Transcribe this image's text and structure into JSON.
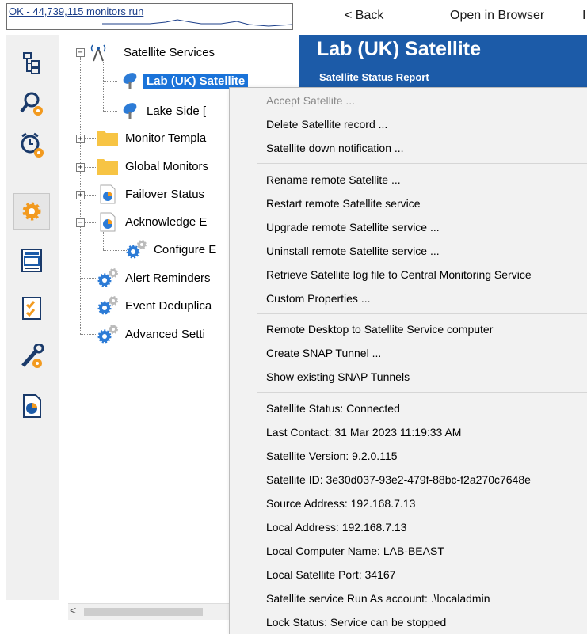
{
  "status_strip": {
    "text": "OK - 44,739,115 monitors run"
  },
  "browser_nav": {
    "back_label": "< Back",
    "open_label": "Open in Browser",
    "extra_label": "I"
  },
  "banner": {
    "title": "Lab (UK) Satellite",
    "subtitle": "Satellite Status Report"
  },
  "sidebar_icons": [
    "tree-view-icon",
    "search-gear-icon",
    "alarm-clock-icon",
    "settings-gear-icon",
    "news-report-icon",
    "checklist-icon",
    "tools-wrench-icon",
    "pie-report-icon"
  ],
  "tree": {
    "satellite_services": "Satellite Services",
    "lab_uk": "Lab (UK) Satellite",
    "lake_side": "Lake Side [",
    "monitor_templates": "Monitor Templa",
    "global_monitors": "Global Monitors",
    "failover_status": "Failover Status",
    "acknowledge": "Acknowledge E",
    "configure": "Configure E",
    "alert_reminders": "Alert Reminders",
    "event_dedup": "Event Deduplica",
    "advanced": "Advanced Setti"
  },
  "menu": {
    "items": [
      {
        "label": "Accept Satellite ...",
        "enabled": false
      },
      {
        "label": "Delete Satellite record ...",
        "enabled": true
      },
      {
        "label": "Satellite down notification ...",
        "enabled": true
      },
      {
        "label": "Rename remote Satellite ...",
        "enabled": true
      },
      {
        "label": "Restart remote Satellite service",
        "enabled": true
      },
      {
        "label": "Upgrade remote Satellite service ...",
        "enabled": true
      },
      {
        "label": "Uninstall remote Satellite service ...",
        "enabled": true
      },
      {
        "label": "Retrieve Satellite log file to Central Monitoring Service",
        "enabled": true
      },
      {
        "label": "Custom Properties ...",
        "enabled": true
      },
      {
        "label": "Remote Desktop to Satellite Service computer",
        "enabled": true
      },
      {
        "label": "Create SNAP Tunnel ...",
        "enabled": true
      },
      {
        "label": "Show existing SNAP Tunnels",
        "enabled": true
      },
      {
        "label": "Satellite Status: Connected",
        "enabled": true
      },
      {
        "label": "Last Contact: 31 Mar 2023 11:19:33 AM",
        "enabled": true
      },
      {
        "label": "Satellite Version: 9.2.0.115",
        "enabled": true
      },
      {
        "label": "Satellite ID: 3e30d037-93e2-479f-88bc-f2a270c7648e",
        "enabled": true
      },
      {
        "label": "Source Address: 192.168.7.13",
        "enabled": true
      },
      {
        "label": "Local Address: 192.168.7.13",
        "enabled": true
      },
      {
        "label": "Local Computer Name: LAB-BEAST",
        "enabled": true
      },
      {
        "label": "Local Satellite Port: 34167",
        "enabled": true
      },
      {
        "label": "Satellite service Run As account: .\\localadmin",
        "enabled": true
      },
      {
        "label": "Lock Status: Service can be stopped",
        "enabled": true
      }
    ]
  },
  "colors": {
    "banner": "#1c5ba8",
    "selection": "#1a73d9",
    "gear_orange": "#f29a1f",
    "gear_blue": "#2c7bd6"
  }
}
